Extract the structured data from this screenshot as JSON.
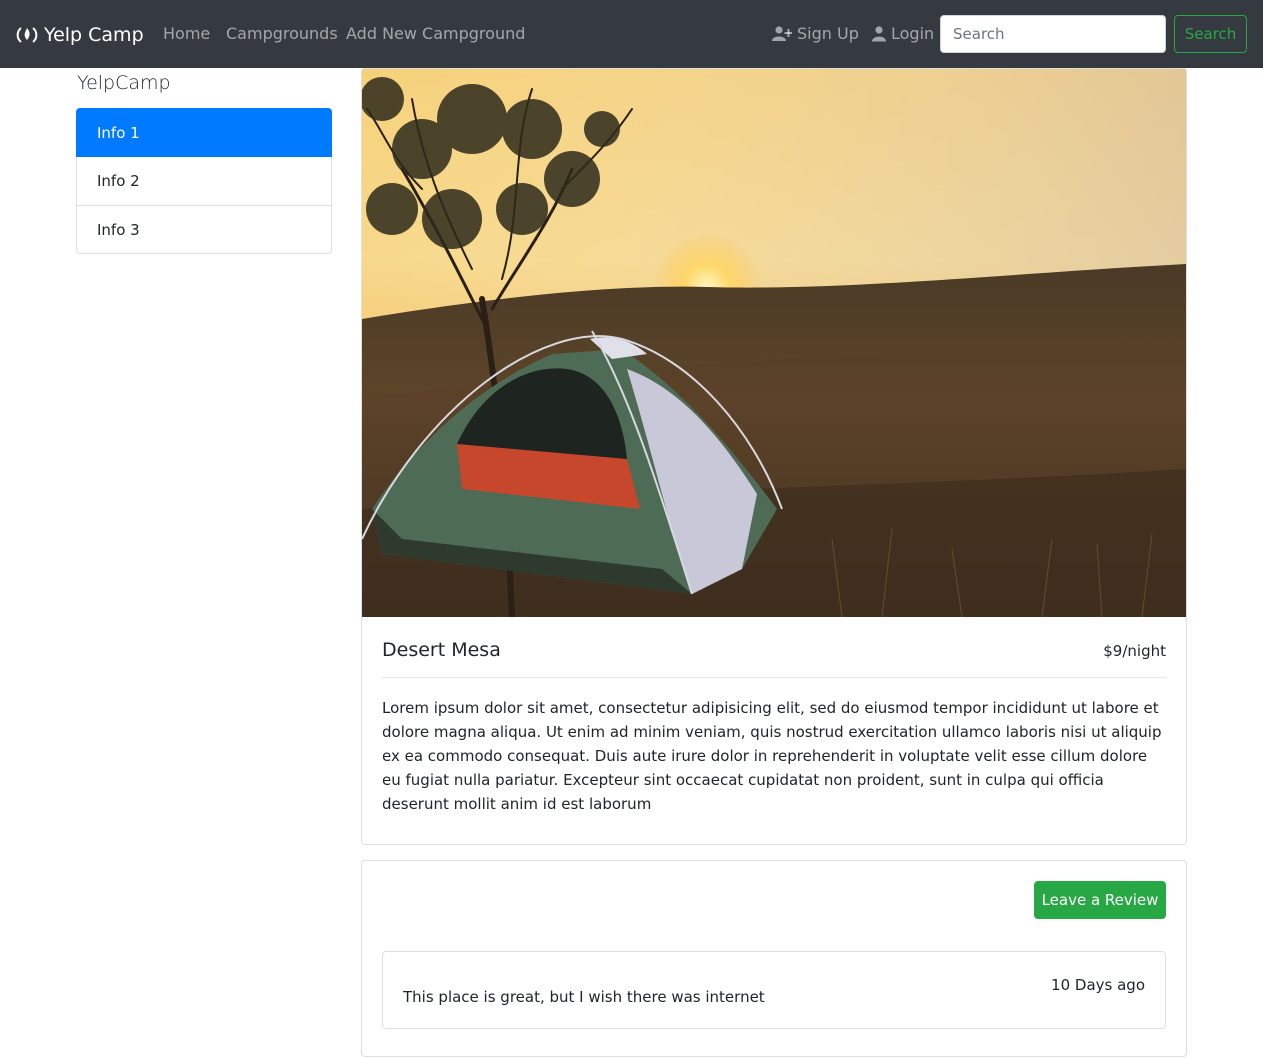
{
  "navbar": {
    "brand": "Yelp Camp",
    "links": {
      "home": "Home",
      "campgrounds": "Campgrounds",
      "add_new": "Add New Campground",
      "sign_up": "Sign Up",
      "login": "Login"
    },
    "search": {
      "placeholder": "Search",
      "button_label": "Search"
    }
  },
  "sidebar": {
    "title": "YelpCamp",
    "items": [
      {
        "label": "Info 1",
        "active": true
      },
      {
        "label": "Info 2",
        "active": false
      },
      {
        "label": "Info 3",
        "active": false
      }
    ]
  },
  "campground": {
    "name": "Desert Mesa",
    "price": "$9/night",
    "description": "Lorem ipsum dolor sit amet, consectetur adipisicing elit, sed do eiusmod tempor incididunt ut labore et dolore magna aliqua. Ut enim ad minim veniam, quis nostrud exercitation ullamco laboris nisi ut aliquip ex ea commodo consequat. Duis aute irure dolor in reprehenderit in voluptate velit esse cillum dolore eu fugiat nulla pariatur. Excepteur sint occaecat cupidatat non proident, sunt in culpa qui officia deserunt mollit anim id est laborum"
  },
  "reviews": {
    "button_label": "Leave a Review",
    "items": [
      {
        "text": "This place is great, but I wish there was internet",
        "time": "10 Days ago"
      }
    ]
  },
  "colors": {
    "navbar_bg": "#343a40",
    "primary": "#007bff",
    "success": "#28a745"
  },
  "icons": {
    "brand": "campfire-icon",
    "sign_up": "user-plus-icon",
    "login": "user-icon"
  }
}
